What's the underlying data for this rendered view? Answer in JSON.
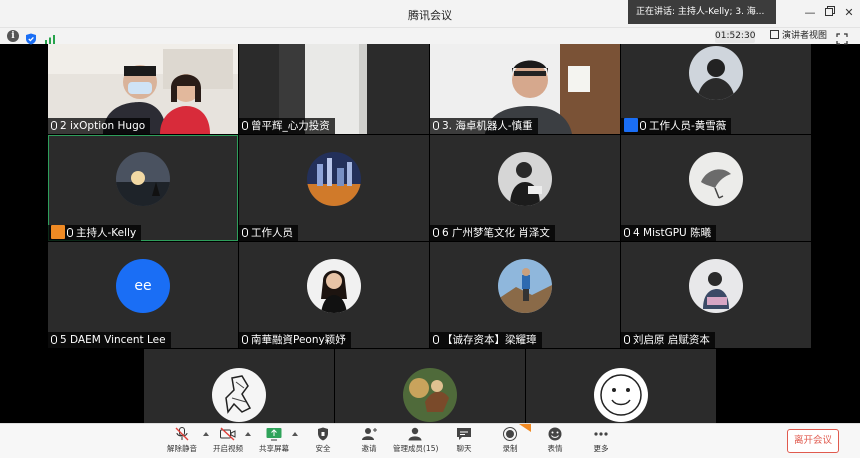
{
  "window": {
    "title": "腾讯会议",
    "speaking_now": "正在讲话: 主持人-Kelly; 3. 海..."
  },
  "infobar": {
    "timer": "01:52:30",
    "speaker_view_label": "演讲者视图"
  },
  "participants": [
    {
      "name": "2 ixOption Hugo"
    },
    {
      "name": "曾平辉_心力投资"
    },
    {
      "name": "3. 海卓机器人-慎重"
    },
    {
      "name": "工作人员-黄雪薇"
    },
    {
      "name": "主持人-Kelly"
    },
    {
      "name": "工作人员"
    },
    {
      "name": "6 广州梦笔文化 肖泽文"
    },
    {
      "name": "4 MistGPU 陈曦"
    },
    {
      "name": "5 DAEM Vincent Lee",
      "avatar_text": "ee"
    },
    {
      "name": "南華融資Peony颖妤"
    },
    {
      "name": "【诚存资本】梁耀璋"
    },
    {
      "name": "刘启原 启赋资本"
    }
  ],
  "toolbar": {
    "unmute": "解除静音",
    "start_video": "开启视频",
    "share_screen": "共享屏幕",
    "security": "安全",
    "invite": "邀请",
    "manage_members": "管理成员(15)",
    "chat": "聊天",
    "record": "录制",
    "reactions": "表情",
    "more": "更多",
    "leave": "离开会议"
  },
  "colors": {
    "accent_blue": "#1a6ef5",
    "leave_red": "#e05a4e",
    "host_orange": "#f08a24",
    "tile_bg": "#2b2b2b"
  }
}
